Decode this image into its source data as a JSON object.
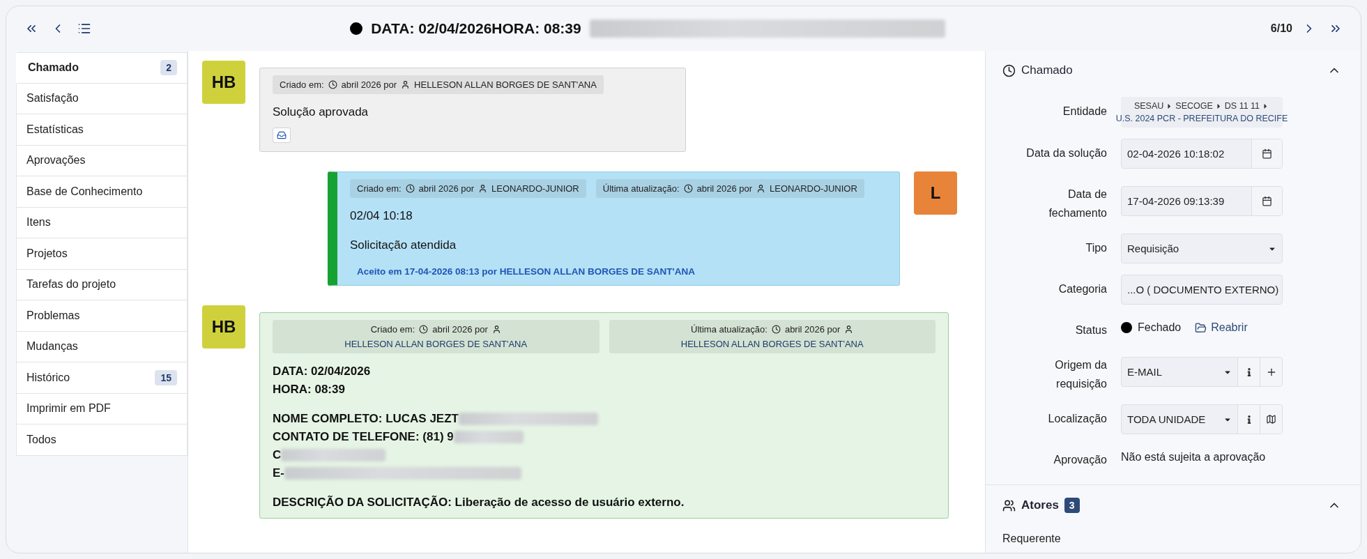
{
  "header": {
    "title": "DATA: 02/04/2026HORA: 08:39",
    "title_redacted": true,
    "counter": "6/10"
  },
  "sidebar": {
    "items": [
      {
        "label": "Chamado",
        "badge": "2",
        "selected": true
      },
      {
        "label": "Satisfação",
        "selected": false
      },
      {
        "label": "Estatísticas",
        "selected": false
      },
      {
        "label": "Aprovações",
        "selected": false
      },
      {
        "label": "Base de Conhecimento",
        "selected": false
      },
      {
        "label": "Itens",
        "selected": false
      },
      {
        "label": "Projetos",
        "selected": false
      },
      {
        "label": "Tarefas do projeto",
        "selected": false
      },
      {
        "label": "Problemas",
        "selected": false
      },
      {
        "label": "Mudanças",
        "selected": false
      },
      {
        "label": "Histórico",
        "badge": "15",
        "selected": false
      },
      {
        "label": "Imprimir em PDF",
        "selected": false
      },
      {
        "label": "Todos",
        "selected": false
      }
    ]
  },
  "timeline": {
    "messages": [
      {
        "kind": "followup",
        "avatar": "HB",
        "color": "#cfd13c",
        "has_attachment": true,
        "meta": [
          {
            "label": "Criado em:",
            "date": "abril 2026 por",
            "user": "HELLESON ALLAN BORGES DE SANT'ANA"
          }
        ],
        "blocks": [
          [
            {
              "text": "Solução aprovada",
              "redacted": false
            }
          ]
        ]
      },
      {
        "kind": "solution",
        "avatar": "L",
        "color": "#e8843a",
        "meta": [
          {
            "label": "Criado em:",
            "date": "abril 2026 por",
            "user": "LEONARDO-JUNIOR"
          },
          {
            "label": "Última atualização:",
            "date": "abril 2026 por",
            "user": "LEONARDO-JUNIOR"
          }
        ],
        "blocks": [
          [
            {
              "text": "02/04 10:18",
              "redacted": false
            }
          ],
          [
            {
              "text": "Solicitação atendida",
              "redacted": false
            }
          ]
        ],
        "accepted": "Aceito em 17-04-2026 08:13 por HELLESON ALLAN BORGES DE SANT'ANA"
      },
      {
        "kind": "content",
        "avatar": "HB",
        "color": "#cfd13c",
        "meta": [
          {
            "label": "Criado em:",
            "date": "abril 2026 por",
            "user": "HELLESON ALLAN BORGES DE SANT'ANA"
          },
          {
            "label": "Última atualização:",
            "date": "abril 2026 por",
            "user": "HELLESON ALLAN BORGES DE SANT'ANA"
          }
        ],
        "blocks": [
          [
            {
              "text": "DATA: 02/04/2026",
              "redacted": false
            },
            {
              "text": "HORA: 08:39",
              "redacted": false
            }
          ],
          [
            {
              "text": "NOME COMPLETO: LUCAS JEZT",
              "redacted": true
            },
            {
              "text": "CONTATO DE TELEFONE: (81) 9",
              "redacted": true
            },
            {
              "text": "C",
              "redacted": true
            },
            {
              "text": "E-",
              "redacted": true
            }
          ],
          [
            {
              "text": "DESCRIÇÃO DA SOLICITAÇÃO: Liberação de acesso de usuário externo.",
              "redacted": false
            }
          ]
        ]
      }
    ]
  },
  "panel": {
    "sections": [
      {
        "title": "Chamado",
        "expanded": true,
        "fields": [
          {
            "kind": "entity",
            "label": "Entidade",
            "path": [
              "SESAU",
              "SECOGE",
              "DS 11 11"
            ],
            "value": "U.S. 2024 PCR - PREFEITURA DO RECIFE"
          },
          {
            "kind": "date",
            "label": "Data da solução",
            "value": "02-04-2026 10:18:02"
          },
          {
            "kind": "date",
            "label": "Data de fechamento",
            "value": "17-04-2026 09:13:39"
          },
          {
            "kind": "select",
            "label": "Tipo",
            "value": "Requisição"
          },
          {
            "kind": "category",
            "label": "Categoria",
            "value": "...O ( DOCUMENTO EXTERNO)"
          },
          {
            "kind": "status",
            "label": "Status",
            "value": "Fechado",
            "color": "#000000",
            "action": "Reabrir"
          },
          {
            "kind": "select",
            "label": "Origem da requisição",
            "value": "E-MAIL",
            "addons": [
              {
                "kind": "info"
              },
              {
                "kind": "add"
              }
            ]
          },
          {
            "kind": "select",
            "label": "Localização",
            "value": "TODA UNIDADE",
            "addons": [
              {
                "kind": "info"
              },
              {
                "kind": "map"
              }
            ]
          },
          {
            "kind": "text",
            "label": "Aprovação",
            "value": "Não está sujeita a aprovação"
          }
        ]
      },
      {
        "title": "Atores",
        "badge": "3",
        "expanded": true,
        "fields": [
          {
            "kind": "heading",
            "label": "Requerente"
          }
        ]
      }
    ]
  }
}
